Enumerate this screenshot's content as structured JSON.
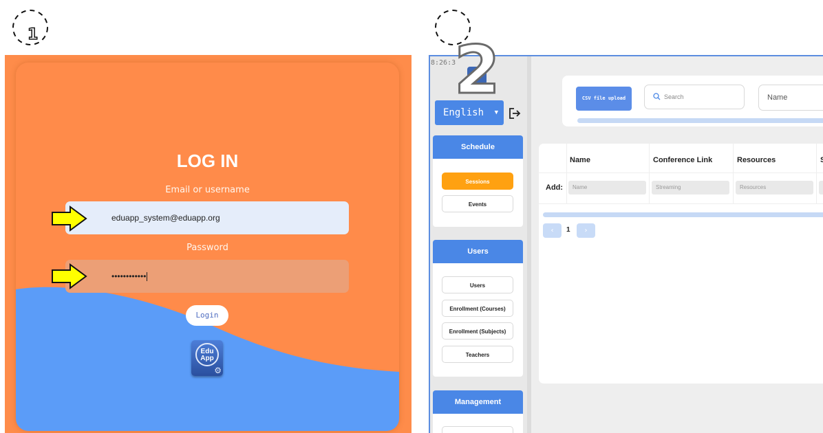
{
  "steps": {
    "step1": "1",
    "step2": "2"
  },
  "login": {
    "title": "LOG IN",
    "email_label": "Email or username",
    "email_value": "eduapp_system@eduapp.org",
    "password_label": "Password",
    "password_value": "••••••••••••",
    "login_button": "Login",
    "logo_text_line1": "Edu",
    "logo_text_line2": "App"
  },
  "app": {
    "clock": "8:26:3",
    "language": "English",
    "sidebar": {
      "schedule": {
        "title": "Schedule",
        "items": [
          "Sessions",
          "Events"
        ],
        "active": "Sessions"
      },
      "users": {
        "title": "Users",
        "items": [
          "Users",
          "Enrollment (Courses)",
          "Enrollment (Subjects)",
          "Teachers"
        ]
      },
      "management": {
        "title": "Management"
      }
    },
    "toolbar": {
      "csv_button": "CSV file upload",
      "search_placeholder": "Search",
      "filter_select": "Name"
    },
    "table": {
      "headers": [
        "Name",
        "Conference Link",
        "Resources",
        "S"
      ],
      "add_label": "Add:",
      "add_placeholders": [
        "Name",
        "Streaming",
        "Resources"
      ]
    },
    "pagination": {
      "current": "1",
      "prev": "‹",
      "next": "›"
    }
  },
  "colors": {
    "orange": "#fe8c4a",
    "blue": "#4a87e6",
    "active": "#ffa111"
  },
  "icons": [
    "arrow-right-icon",
    "logout-icon",
    "search-icon",
    "chevron-down-icon",
    "gear-icon"
  ]
}
